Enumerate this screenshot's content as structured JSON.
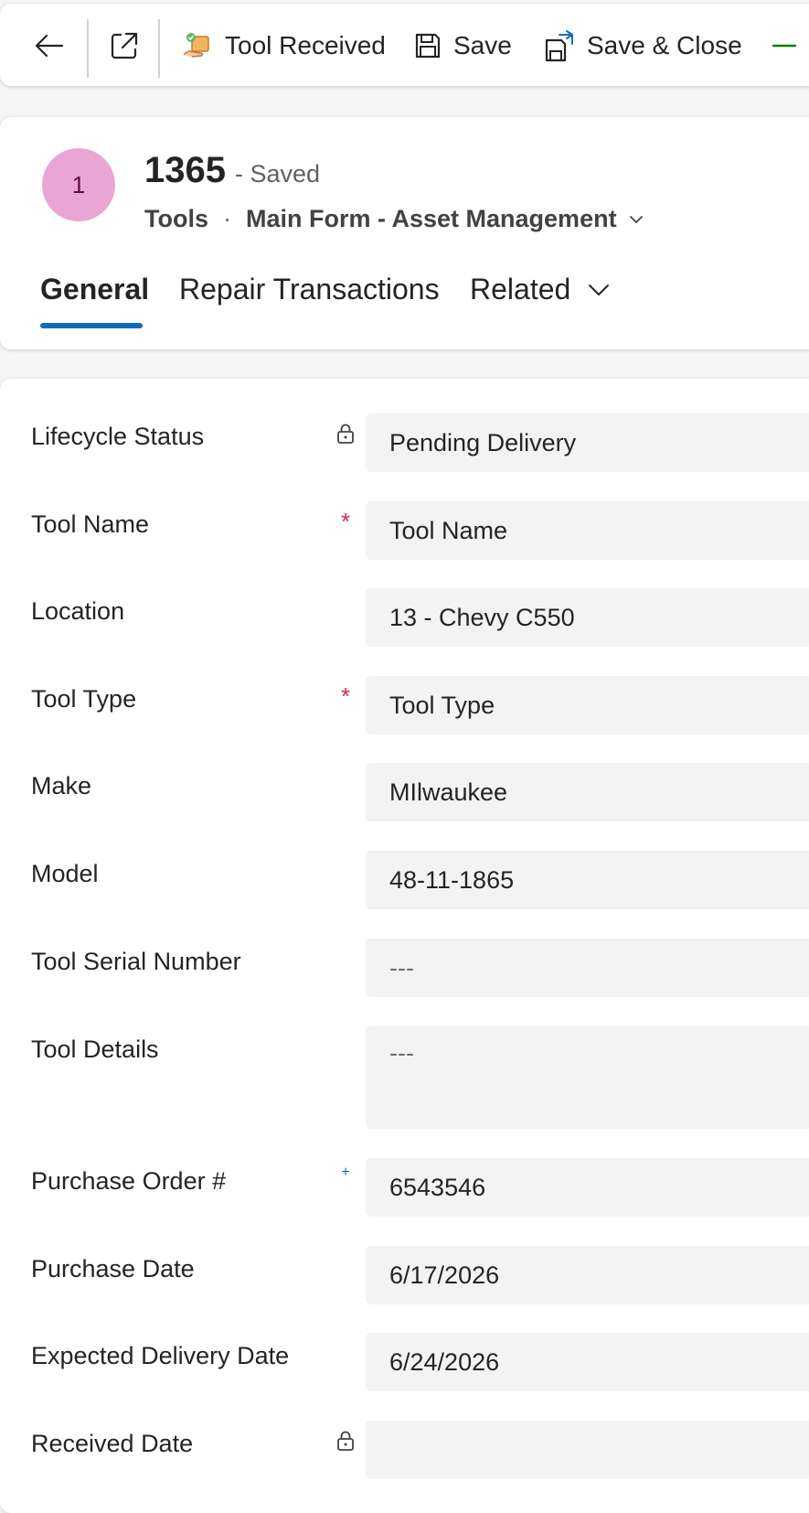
{
  "toolbar": {
    "tool_received_label": "Tool Received",
    "save_label": "Save",
    "save_close_label": "Save & Close"
  },
  "record": {
    "avatar_initial": "1",
    "number": "1365",
    "status": "- Saved",
    "entity": "Tools",
    "separator": "·",
    "form_name": "Main Form - Asset Management"
  },
  "tabs": [
    {
      "label": "General",
      "active": true
    },
    {
      "label": "Repair Transactions",
      "active": false
    },
    {
      "label": "Related",
      "active": false
    }
  ],
  "fields": {
    "lifecycle_status": {
      "label": "Lifecycle Status",
      "value": "Pending Delivery",
      "indicator": "lock-icon"
    },
    "tool_name": {
      "label": "Tool Name",
      "value": "Tool Name",
      "indicator": "required"
    },
    "location": {
      "label": "Location",
      "value": "13 - Chevy C550"
    },
    "tool_type": {
      "label": "Tool Type",
      "value": "Tool Type",
      "indicator": "required"
    },
    "make": {
      "label": "Make",
      "value": "MIlwaukee"
    },
    "model": {
      "label": "Model",
      "value": "48-11-1865"
    },
    "tool_serial_number": {
      "label": "Tool Serial Number",
      "value": "---"
    },
    "tool_details": {
      "label": "Tool Details",
      "value": "---"
    },
    "purchase_order": {
      "label": "Purchase Order #",
      "value": "6543546",
      "indicator": "recommended"
    },
    "purchase_date": {
      "label": "Purchase Date",
      "value": "6/17/2026"
    },
    "expected_delivery_date": {
      "label": "Expected Delivery Date",
      "value": "6/24/2026"
    },
    "received_date": {
      "label": "Received Date",
      "value": "",
      "indicator": "lock-icon"
    }
  },
  "indicator_glyphs": {
    "required": "*",
    "recommended": "+"
  },
  "colors": {
    "accent": "#0f6cbd",
    "required": "#c4314b",
    "avatar_bg": "#e9a5d4",
    "save_close_green": "#107c10"
  }
}
